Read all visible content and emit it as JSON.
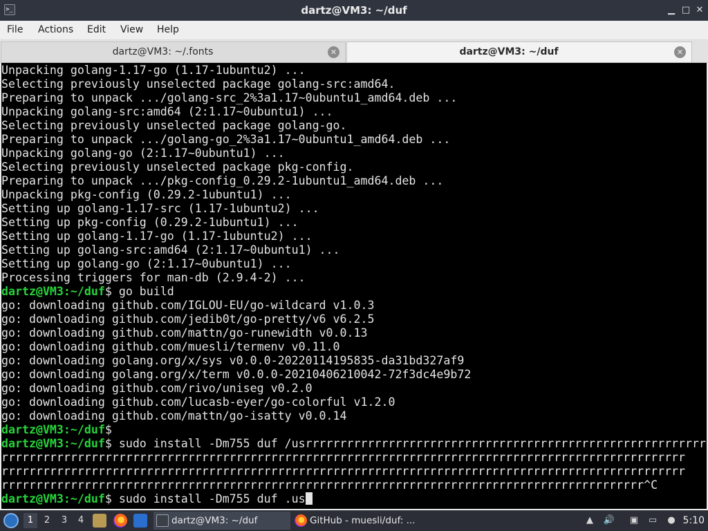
{
  "window": {
    "title": "dartz@VM3: ~/duf",
    "minimize_glyph": "▁",
    "maximize_glyph": "□",
    "close_glyph": "✕"
  },
  "menu": [
    "File",
    "Actions",
    "Edit",
    "View",
    "Help"
  ],
  "tabs": [
    {
      "label": "dartz@VM3: ~/.fonts",
      "active": false
    },
    {
      "label": "dartz@VM3: ~/duf",
      "active": true
    }
  ],
  "terminal": {
    "lines": [
      {
        "text": "Unpacking golang-1.17-go (1.17-1ubuntu2) ..."
      },
      {
        "text": "Selecting previously unselected package golang-src:amd64."
      },
      {
        "text": "Preparing to unpack .../golang-src_2%3a1.17~0ubuntu1_amd64.deb ..."
      },
      {
        "text": "Unpacking golang-src:amd64 (2:1.17~0ubuntu1) ..."
      },
      {
        "text": "Selecting previously unselected package golang-go."
      },
      {
        "text": "Preparing to unpack .../golang-go_2%3a1.17~0ubuntu1_amd64.deb ..."
      },
      {
        "text": "Unpacking golang-go (2:1.17~0ubuntu1) ..."
      },
      {
        "text": "Selecting previously unselected package pkg-config."
      },
      {
        "text": "Preparing to unpack .../pkg-config_0.29.2-1ubuntu1_amd64.deb ..."
      },
      {
        "text": "Unpacking pkg-config (0.29.2-1ubuntu1) ..."
      },
      {
        "text": "Setting up golang-1.17-src (1.17-1ubuntu2) ..."
      },
      {
        "text": "Setting up pkg-config (0.29.2-1ubuntu1) ..."
      },
      {
        "text": "Setting up golang-1.17-go (1.17-1ubuntu2) ..."
      },
      {
        "text": "Setting up golang-src:amd64 (2:1.17~0ubuntu1) ..."
      },
      {
        "text": "Setting up golang-go (2:1.17~0ubuntu1) ..."
      },
      {
        "text": "Processing triggers for man-db (2.9.4-2) ..."
      },
      {
        "prompt": "dartz@VM3:",
        "path": "~/duf",
        "text": "$ go build"
      },
      {
        "text": "go: downloading github.com/IGLOU-EU/go-wildcard v1.0.3"
      },
      {
        "text": "go: downloading github.com/jedib0t/go-pretty/v6 v6.2.5"
      },
      {
        "text": "go: downloading github.com/mattn/go-runewidth v0.0.13"
      },
      {
        "text": "go: downloading github.com/muesli/termenv v0.11.0"
      },
      {
        "text": "go: downloading golang.org/x/sys v0.0.0-20220114195835-da31bd327af9"
      },
      {
        "text": "go: downloading golang.org/x/term v0.0.0-20210406210042-72f3dc4e9b72"
      },
      {
        "text": "go: downloading github.com/rivo/uniseg v0.2.0"
      },
      {
        "text": "go: downloading github.com/lucasb-eyer/go-colorful v1.2.0"
      },
      {
        "text": "go: downloading github.com/mattn/go-isatty v0.0.14"
      },
      {
        "prompt": "dartz@VM3:",
        "path": "~/duf",
        "text": "$"
      },
      {
        "prompt": "dartz@VM3:",
        "path": "~/duf",
        "text": "$ sudo install -Dm755 duf /usrrrrrrrrrrrrrrrrrrrrrrrrrrrrrrrrrrrrrrrrrrrrrrrrrrrrrrrrrrrrrrr"
      },
      {
        "text": "rrrrrrrrrrrrrrrrrrrrrrrrrrrrrrrrrrrrrrrrrrrrrrrrrrrrrrrrrrrrrrrrrrrrrrrrrrrrrrrrrrrrrrrrrrrrrrrrrrr"
      },
      {
        "text": "rrrrrrrrrrrrrrrrrrrrrrrrrrrrrrrrrrrrrrrrrrrrrrrrrrrrrrrrrrrrrrrrrrrrrrrrrrrrrrrrrrrrrrrrrrrrrrrrrrr"
      },
      {
        "text": "rrrrrrrrrrrrrrrrrrrrrrrrrrrrrrrrrrrrrrrrrrrrrrrrrrrrrrrrrrrrrrrrrrrrrrrrrrrrrrrrrrrrrrrrrrrrr^C"
      },
      {
        "prompt": "dartz@VM3:",
        "path": "~/duf",
        "text": "$ sudo install -Dm755 duf .us",
        "cursor": true
      }
    ]
  },
  "taskbar": {
    "workspaces": [
      "1",
      "2",
      "3",
      "4"
    ],
    "tasks": [
      {
        "label": "dartz@VM3: ~/duf",
        "icon": "terminal-icon",
        "active": true
      },
      {
        "label": "GitHub - muesli/duf: ...",
        "icon": "firefox-icon",
        "active": false
      }
    ],
    "clock": "5:10"
  }
}
